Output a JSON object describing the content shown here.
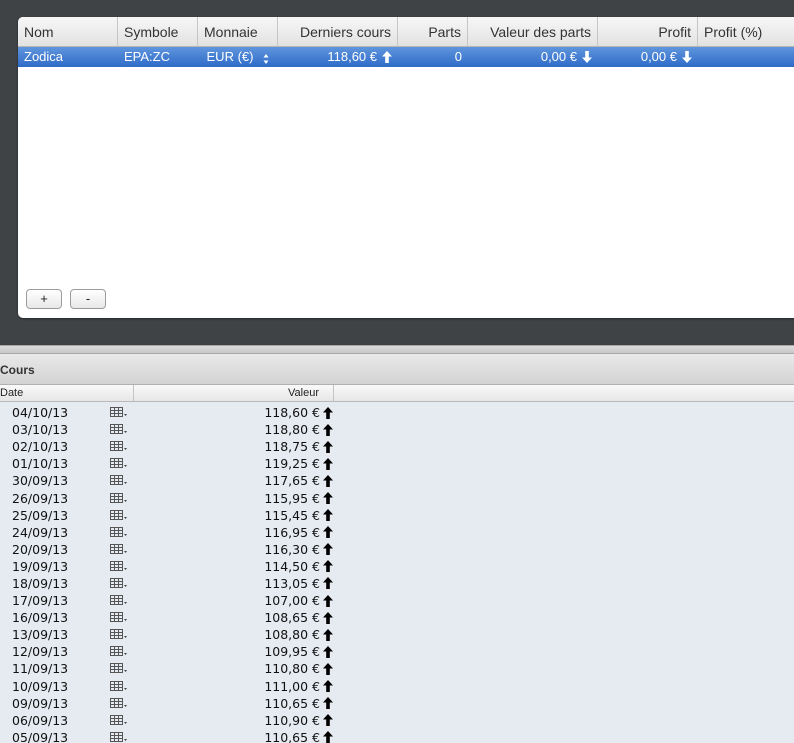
{
  "portfolio": {
    "columns": [
      "Nom",
      "Symbole",
      "Monnaie",
      "Derniers cours",
      "Parts",
      "Valeur des parts",
      "Profit",
      "Profit (%)"
    ],
    "selected_row": {
      "nom": "Zodica",
      "symbole": "EPA:ZC",
      "monnaie": "EUR (€)",
      "derniers_cours": "118,60 €",
      "parts": "0",
      "valeur_des_parts": "0,00 €",
      "profit": "0,00 €",
      "profit_pct": ""
    },
    "add_button": "+",
    "remove_button": "-"
  },
  "cours": {
    "title": "Cours",
    "col_date": "Date",
    "col_valeur": "Valeur",
    "rows": [
      {
        "date": "04/10/13",
        "valeur": "118,60 €"
      },
      {
        "date": "03/10/13",
        "valeur": "118,80 €"
      },
      {
        "date": "02/10/13",
        "valeur": "118,75 €"
      },
      {
        "date": "01/10/13",
        "valeur": "119,25 €"
      },
      {
        "date": "30/09/13",
        "valeur": "117,65 €"
      },
      {
        "date": "26/09/13",
        "valeur": "115,95 €"
      },
      {
        "date": "25/09/13",
        "valeur": "115,45 €"
      },
      {
        "date": "24/09/13",
        "valeur": "116,95 €"
      },
      {
        "date": "20/09/13",
        "valeur": "116,30 €"
      },
      {
        "date": "19/09/13",
        "valeur": "114,50 €"
      },
      {
        "date": "18/09/13",
        "valeur": "113,05 €"
      },
      {
        "date": "17/09/13",
        "valeur": "107,00 €"
      },
      {
        "date": "16/09/13",
        "valeur": "108,65 €"
      },
      {
        "date": "13/09/13",
        "valeur": "108,80 €"
      },
      {
        "date": "12/09/13",
        "valeur": "109,95 €"
      },
      {
        "date": "11/09/13",
        "valeur": "110,80 €"
      },
      {
        "date": "10/09/13",
        "valeur": "111,00 €"
      },
      {
        "date": "09/09/13",
        "valeur": "110,65 €"
      },
      {
        "date": "06/09/13",
        "valeur": "110,90 €"
      },
      {
        "date": "05/09/13",
        "valeur": "110,65 €"
      }
    ]
  },
  "colors": {
    "selection": "#2e6bc8",
    "window_bg": "#3f4346",
    "list_bg": "#e6ebf2"
  }
}
